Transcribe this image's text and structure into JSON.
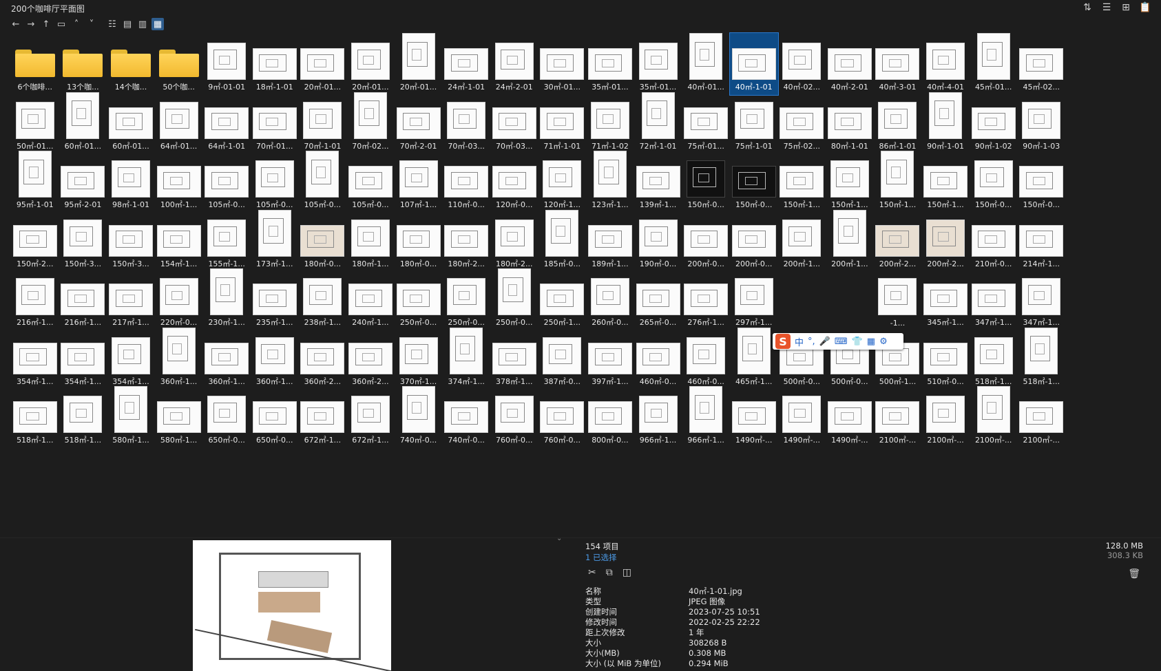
{
  "window": {
    "title": "200个咖啡厅平面图"
  },
  "top_right_icons": [
    "sort-icon",
    "details-pane-icon",
    "new-window-icon",
    "clipboard-icon"
  ],
  "toolbar": {
    "icons": [
      "back-arrow-icon",
      "forward-arrow-icon",
      "up-arrow-icon",
      "folder-icon",
      "chevron-up-icon",
      "chevron-down-icon"
    ],
    "views": [
      "list-view-icon",
      "details-view-icon",
      "tiles-view-icon",
      "thumbnails-view-icon"
    ],
    "active_view": "thumbnails-view-icon"
  },
  "files": [
    [
      "6个咖啡...",
      "13个咖...",
      "14个咖...",
      "50个咖...",
      "9㎡-01-01",
      "18㎡-1-01",
      "20㎡-01...",
      "20㎡-01...",
      "20㎡-01...",
      "24㎡-1-01",
      "24㎡-2-01",
      "30㎡-01...",
      "35㎡-01...",
      "35㎡-01...",
      "40㎡-01...",
      "40㎡-1-01",
      "40㎡-02...",
      "40㎡-2-01",
      "40㎡-3-01",
      "40㎡-4-01",
      "45㎡-01...",
      "45㎡-02..."
    ],
    [
      "50㎡-01...",
      "60㎡-01...",
      "60㎡-01...",
      "64㎡-01...",
      "64㎡-1-01",
      "70㎡-01...",
      "70㎡-1-01",
      "70㎡-02...",
      "70㎡-2-01",
      "70㎡-03...",
      "70㎡-03...",
      "71㎡-1-01",
      "71㎡-1-02",
      "72㎡-1-01",
      "75㎡-01...",
      "75㎡-1-01",
      "75㎡-02...",
      "80㎡-1-01",
      "86㎡-1-01",
      "90㎡-1-01",
      "90㎡-1-02",
      "90㎡-1-03"
    ],
    [
      "95㎡-1-01",
      "95㎡-2-01",
      "98㎡-1-01",
      "100㎡-1...",
      "105㎡-0...",
      "105㎡-0...",
      "105㎡-0...",
      "105㎡-0...",
      "107㎡-1...",
      "110㎡-0...",
      "120㎡-0...",
      "120㎡-1...",
      "123㎡-1...",
      "139㎡-1...",
      "150㎡-0...",
      "150㎡-0...",
      "150㎡-1...",
      "150㎡-1...",
      "150㎡-1...",
      "150㎡-1...",
      "150㎡-0...",
      "150㎡-0..."
    ],
    [
      "150㎡-2...",
      "150㎡-3...",
      "150㎡-3...",
      "154㎡-1...",
      "155㎡-1...",
      "173㎡-1...",
      "180㎡-0...",
      "180㎡-1...",
      "180㎡-0...",
      "180㎡-2...",
      "180㎡-2...",
      "185㎡-0...",
      "189㎡-1...",
      "190㎡-0...",
      "200㎡-0...",
      "200㎡-0...",
      "200㎡-1...",
      "200㎡-1...",
      "200㎡-2...",
      "200㎡-2...",
      "210㎡-0...",
      "214㎡-1..."
    ],
    [
      "216㎡-1...",
      "216㎡-1...",
      "217㎡-1...",
      "220㎡-0...",
      "230㎡-1...",
      "235㎡-1...",
      "238㎡-1...",
      "240㎡-1...",
      "250㎡-0...",
      "250㎡-0...",
      "250㎡-0...",
      "250㎡-1...",
      "260㎡-0...",
      "265㎡-0...",
      "276㎡-1...",
      "297㎡-1...",
      "",
      "",
      "-1...",
      "345㎡-1...",
      "347㎡-1...",
      "347㎡-1..."
    ],
    [
      "354㎡-1...",
      "354㎡-1...",
      "354㎡-1...",
      "360㎡-1...",
      "360㎡-1...",
      "360㎡-1...",
      "360㎡-2...",
      "360㎡-2...",
      "370㎡-1...",
      "374㎡-1...",
      "378㎡-1...",
      "387㎡-0...",
      "397㎡-1...",
      "460㎡-0...",
      "460㎡-0...",
      "465㎡-1...",
      "500㎡-0...",
      "500㎡-0...",
      "500㎡-1...",
      "510㎡-0...",
      "518㎡-1...",
      "518㎡-1..."
    ],
    [
      "518㎡-1...",
      "518㎡-1...",
      "580㎡-1...",
      "580㎡-1...",
      "650㎡-0...",
      "650㎡-0...",
      "672㎡-1...",
      "672㎡-1...",
      "740㎡-0...",
      "740㎡-0...",
      "760㎡-0...",
      "760㎡-0...",
      "800㎡-0...",
      "966㎡-1...",
      "966㎡-1...",
      "1490㎡-...",
      "1490㎡-...",
      "1490㎡-...",
      "2100㎡-...",
      "2100㎡-...",
      "2100㎡-...",
      "2100㎡-..."
    ]
  ],
  "selected_file": "40㎡-1-01",
  "ime_toolbar": {
    "logo": "S",
    "items": [
      "中",
      "°,",
      "🎤",
      "⌨",
      "👕",
      "▦",
      "⚙"
    ]
  },
  "status": {
    "item_count": "154 项目",
    "selected_count": "1 已选择",
    "total_size": "128.0 MB",
    "selected_size": "308.3 KB"
  },
  "actions": [
    "cut-icon",
    "copy-icon",
    "compare-icon"
  ],
  "properties": [
    {
      "key": "名称",
      "value": "40㎡-1-01.jpg"
    },
    {
      "key": "类型",
      "value": "JPEG 图像"
    },
    {
      "key": "创建时间",
      "value": "2023-07-25  10:51"
    },
    {
      "key": "修改时间",
      "value": "2022-02-25  22:22"
    },
    {
      "key": "距上次修改",
      "value": "1 年"
    },
    {
      "key": "大小",
      "value": "308268 B"
    },
    {
      "key": "大小(MB)",
      "value": "0.308 MB"
    },
    {
      "key": "大小 (以 MiB 为单位)",
      "value": "0.294 MiB"
    }
  ]
}
